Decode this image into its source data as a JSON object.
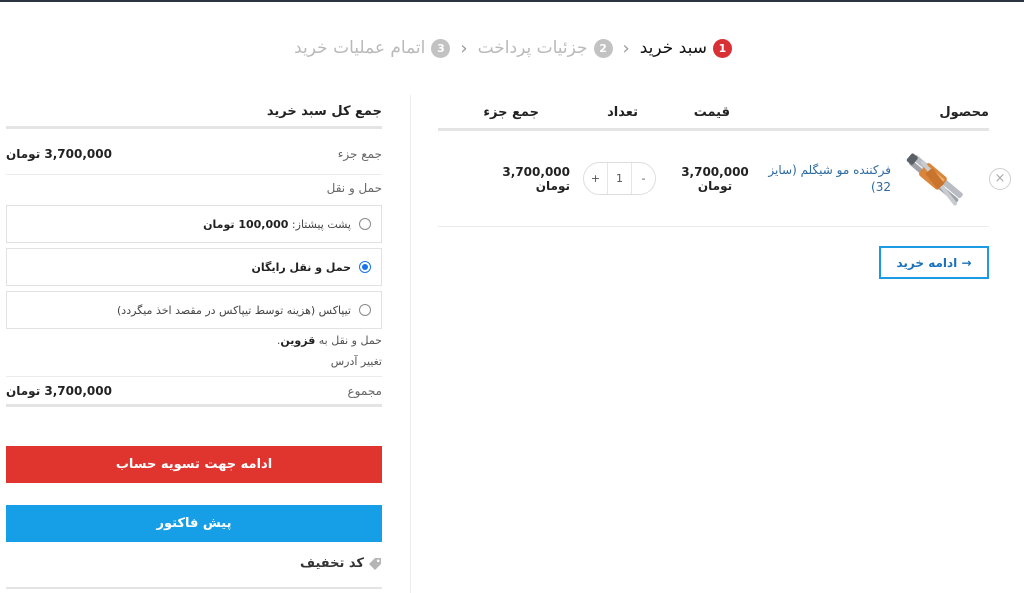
{
  "steps": [
    {
      "num": "1",
      "label": "سبد خرید"
    },
    {
      "num": "2",
      "label": "جزئیات پرداخت"
    },
    {
      "num": "3",
      "label": "اتمام عملیات خرید"
    }
  ],
  "cart": {
    "headers": {
      "product": "محصول",
      "price": "قیمت",
      "quantity": "تعداد",
      "subtotal": "جمع جزء"
    },
    "items": [
      {
        "name": "فرکننده مو شیگلم (سایز 32)",
        "price": "3,700,000 تومان",
        "qty": "1",
        "subtotal": "3,700,000 تومان",
        "minus": "-",
        "plus": "+",
        "remove": "×"
      }
    ],
    "continue_label": "→ ادامه خرید"
  },
  "totals": {
    "title": "جمع کل سبد خرید",
    "subtotal_label": "جمع جزء",
    "subtotal_value": "3,700,000 تومان",
    "shipping_title": "حمل و نقل",
    "options": [
      {
        "label": "پشت پیشتاز: ",
        "amount": "100,000 تومان",
        "selected": false
      },
      {
        "label": "حمل و نقل رایگان",
        "amount": "",
        "selected": true
      },
      {
        "label": "تیپاکس (هزینه توسط تیپاکس در مقصد اخذ میگردد)",
        "amount": "",
        "selected": false
      }
    ],
    "ship_to_prefix": "حمل و نقل به ",
    "ship_to_city": "قزوین",
    "ship_to_suffix": ".",
    "change_address": "تغییر آدرس",
    "total_label": "مجموع",
    "total_value": "3,700,000 تومان",
    "checkout_label": "ادامه جهت تسویه حساب",
    "proforma_label": "پیش فاکتور",
    "coupon_label": "کد تخفیف"
  },
  "colors": {
    "checkout": "#e0342f",
    "proforma": "#169fe6",
    "step_active": "#d93036",
    "link": "#2c6aa0"
  },
  "icons": {
    "remove": "close-circle-icon",
    "coupon": "tag-icon",
    "step_separator": "chevron-left-icon"
  }
}
